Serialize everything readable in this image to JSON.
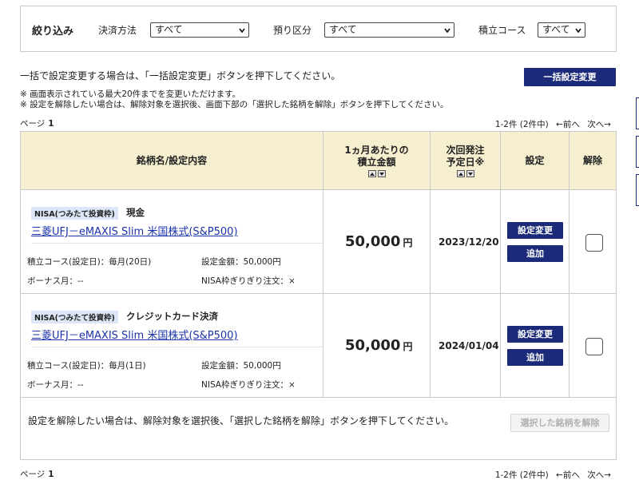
{
  "filter": {
    "title": "絞り込み",
    "payment_label": "決済方法",
    "payment_value": "すべて",
    "deposit_label": "預り区分",
    "deposit_value": "すべて",
    "course_label": "積立コース",
    "course_value": "すべて"
  },
  "notice": {
    "main": "一括で設定変更する場合は、「一括設定変更」ボタンを押下してください。",
    "note1": "※ 画面表示されている最大20件までを変更いただけます。",
    "note2": "※ 設定を解除したい場合は、解除対象を選択後、画面下部の「選択した銘柄を解除」ボタンを押下してください。",
    "bulk_button": "一括設定変更"
  },
  "pagination": {
    "page_label": "ページ",
    "page_number": "1",
    "count_text": "1-2件 (2件中)",
    "prev": "←前へ",
    "next": "次へ→"
  },
  "table": {
    "headers": {
      "fund": "銘柄名/設定内容",
      "monthly_line1": "1ヵ月あたりの",
      "monthly_line2": "積立金額",
      "next_line1": "次回発注",
      "next_line2": "予定日※",
      "settings": "設定",
      "release": "解除"
    },
    "rows": [
      {
        "badge": "NISA(つみたて投資枠)",
        "payment": "現金",
        "fund_name": "三菱UFJ－eMAXIS Slim 米国株式(S&P500)",
        "course": "積立コース(設定日)：毎月(20日)",
        "set_amount": "設定金額：50,000円",
        "bonus": "ボーナス月：--",
        "nisa_order": "NISA枠ぎりぎり注文：×",
        "amount": "50,000",
        "amount_unit": "円",
        "next_date": "2023/12/20",
        "change_button": "設定変更",
        "add_button": "追加"
      },
      {
        "badge": "NISA(つみたて投資枠)",
        "payment": "クレジットカード決済",
        "fund_name": "三菱UFJ－eMAXIS Slim 米国株式(S&P500)",
        "course": "積立コース(設定日)：毎月(1日)",
        "set_amount": "設定金額：50,000円",
        "bonus": "ボーナス月：--",
        "nisa_order": "NISA枠ぎりぎり注文：×",
        "amount": "50,000",
        "amount_unit": "円",
        "next_date": "2024/01/04",
        "change_button": "設定変更",
        "add_button": "追加"
      }
    ],
    "footer_note": "設定を解除したい場合は、解除対象を選択後、「選択した銘柄を解除」ボタンを押下してください。",
    "release_button": "選択した銘柄を解除"
  },
  "colors": {
    "navy": "#1b2b7a",
    "header_bg": "#f5efcf",
    "link": "#1a33a8",
    "badge_bg": "#dde6f6"
  }
}
